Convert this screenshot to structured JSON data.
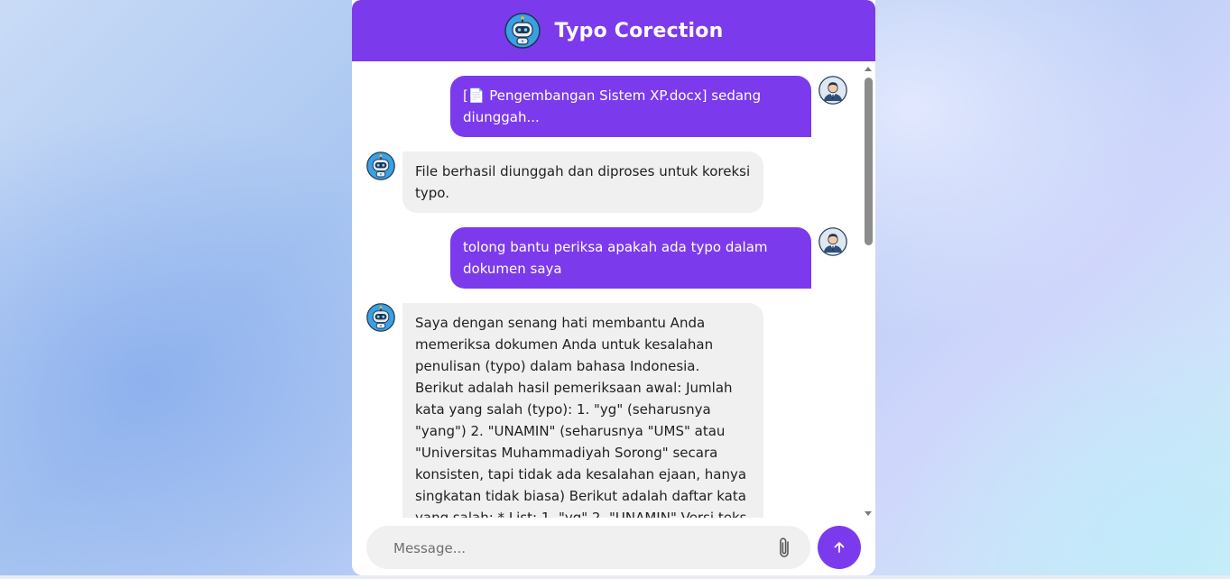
{
  "header": {
    "title": "Typo Corection",
    "bot_icon": "robot-avatar-icon"
  },
  "messages": [
    {
      "role": "user",
      "text": "[📄 Pengembangan Sistem XP.docx] sedang diunggah..."
    },
    {
      "role": "bot",
      "text": "File berhasil diunggah dan diproses untuk koreksi typo."
    },
    {
      "role": "user",
      "text": "tolong bantu periksa apakah ada typo dalam dokumen saya"
    },
    {
      "role": "bot",
      "text": "Saya dengan senang hati membantu Anda memeriksa dokumen Anda untuk kesalahan penulisan (typo) dalam bahasa Indonesia. Berikut adalah hasil pemeriksaan awal: Jumlah kata yang salah (typo): 1. \"yg\" (seharusnya \"yang\") 2. \"UNAMIN\" (seharusnya \"UMS\" atau \"Universitas Muhammadiyah Sorong\" secara konsisten, tapi tidak ada kesalahan ejaan, hanya singkatan tidak biasa) Berikut adalah daftar kata yang salah: * List: 1. \"yg\" 2. \"UNAMIN\" Versi teks yang sudah dikoreksi:"
    }
  ],
  "input": {
    "placeholder": "Message...",
    "value": ""
  },
  "icons": {
    "attach": "paperclip-icon",
    "send": "arrow-up-icon",
    "user": "user-avatar-icon",
    "bot": "robot-avatar-icon"
  },
  "colors": {
    "accent": "#7c3aed",
    "bot_bubble": "#f0f0f0",
    "panel": "#ffffff"
  }
}
